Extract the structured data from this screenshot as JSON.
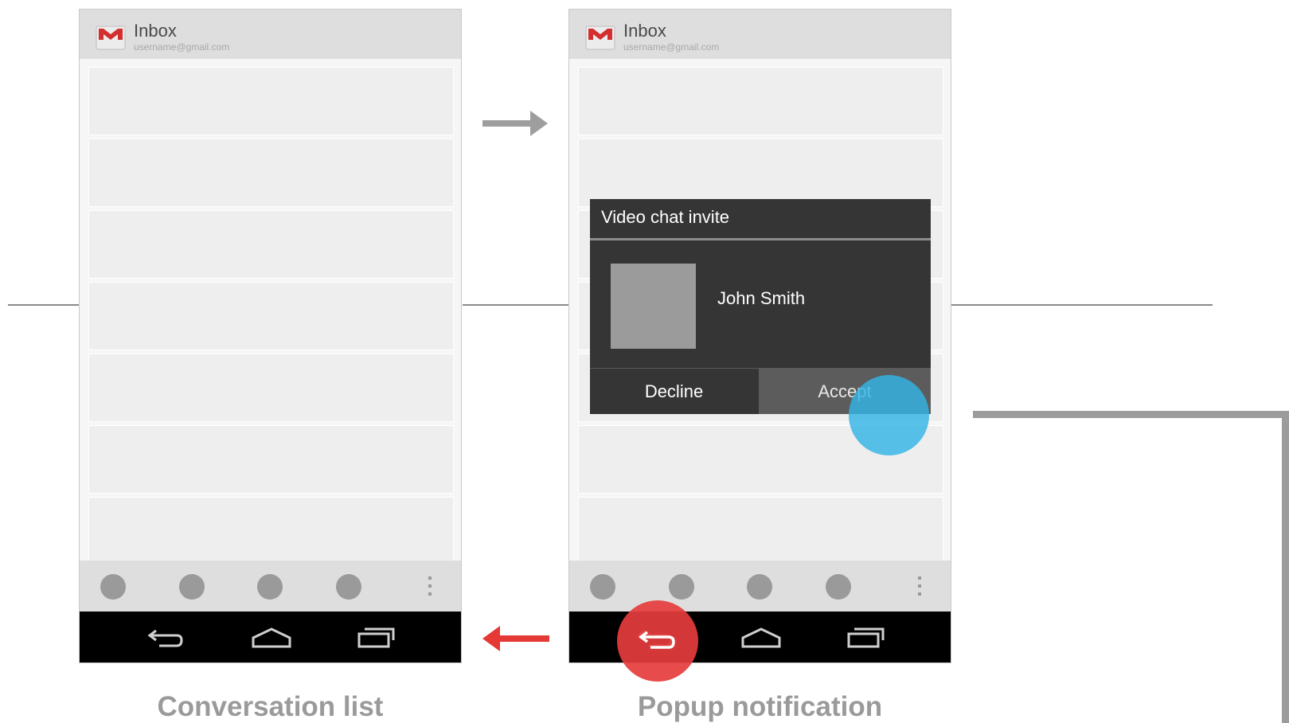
{
  "colors": {
    "action_bar": "#dedede",
    "list_row": "#eeeeee",
    "dialog_bg": "#353535",
    "accept_bg": "#5c5c5c",
    "touch_blue": "#33b5e5",
    "touch_red": "#e63c3c",
    "forward_arrow": "#9e9e9e",
    "back_arrow": "#e53935"
  },
  "screens": [
    {
      "app_icon": "gmail-icon",
      "title": "Inbox",
      "account": "username@gmail.com",
      "caption": "Conversation list",
      "toolbar_icons": [
        "action-icon",
        "action-icon",
        "action-icon",
        "action-icon",
        "overflow-menu-icon"
      ],
      "nav_icons": [
        "back-icon",
        "home-icon",
        "recent-apps-icon"
      ]
    },
    {
      "app_icon": "gmail-icon",
      "title": "Inbox",
      "account": "username@gmail.com",
      "caption": "Popup notification",
      "toolbar_icons": [
        "action-icon",
        "action-icon",
        "action-icon",
        "action-icon",
        "overflow-menu-icon"
      ],
      "nav_icons": [
        "back-icon",
        "home-icon",
        "recent-apps-icon"
      ]
    }
  ],
  "dialog": {
    "title": "Video chat invite",
    "contact_name": "John Smith",
    "decline_label": "Decline",
    "accept_label": "Accept"
  }
}
